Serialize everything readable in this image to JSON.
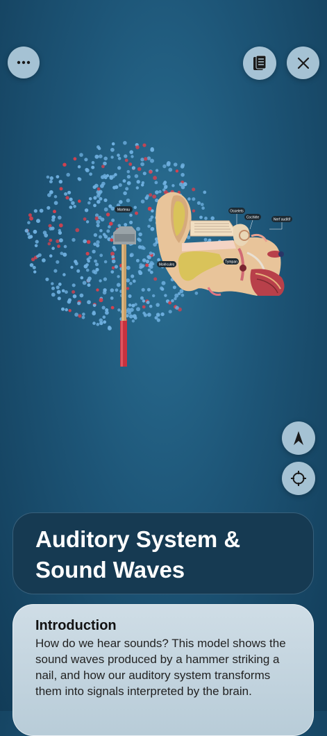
{
  "title": "Auditory System & Sound Waves",
  "toolbar": {
    "menu_icon": "ellipsis-icon",
    "notes_icon": "notes-icon",
    "close_icon": "close-icon"
  },
  "model": {
    "labels": [
      "Marteau",
      "Osselets",
      "Cochlée",
      "Nerf auditif",
      "Tympan",
      "Molécules"
    ]
  },
  "controls": {
    "orientation_icon": "navigation-arrow-icon",
    "recenter_icon": "crosshair-icon"
  },
  "intro": {
    "heading": "Introduction",
    "body": "How do we hear sounds? This model shows the sound waves produced by a hammer striking a nail, and how our auditory system transforms them into signals interpreted by the brain."
  },
  "colors": {
    "background": "#1d5577",
    "card_dark": "#163a52",
    "card_light": "#c4d5df",
    "molecule_blue": "#6fb0e0",
    "molecule_red": "#d6414e"
  }
}
